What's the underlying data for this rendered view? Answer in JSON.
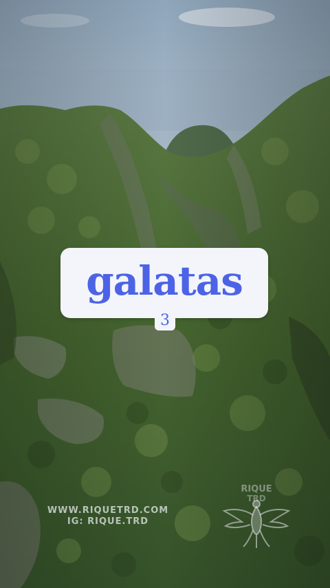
{
  "title": {
    "word": "galatas",
    "number": "3"
  },
  "watermark": {
    "line1": "WWW.RIQUETRD.COM",
    "line2": "IG: RIQUE.TRD",
    "logo_text": "RIQUE TRD"
  },
  "colors": {
    "title_text": "#4d63e6",
    "card_background": "#f3f5fb",
    "sky": "#9fb4c8",
    "forest": "#4b6a36"
  },
  "icons": {
    "watermark_logo": "phoenix-emblem-icon"
  }
}
